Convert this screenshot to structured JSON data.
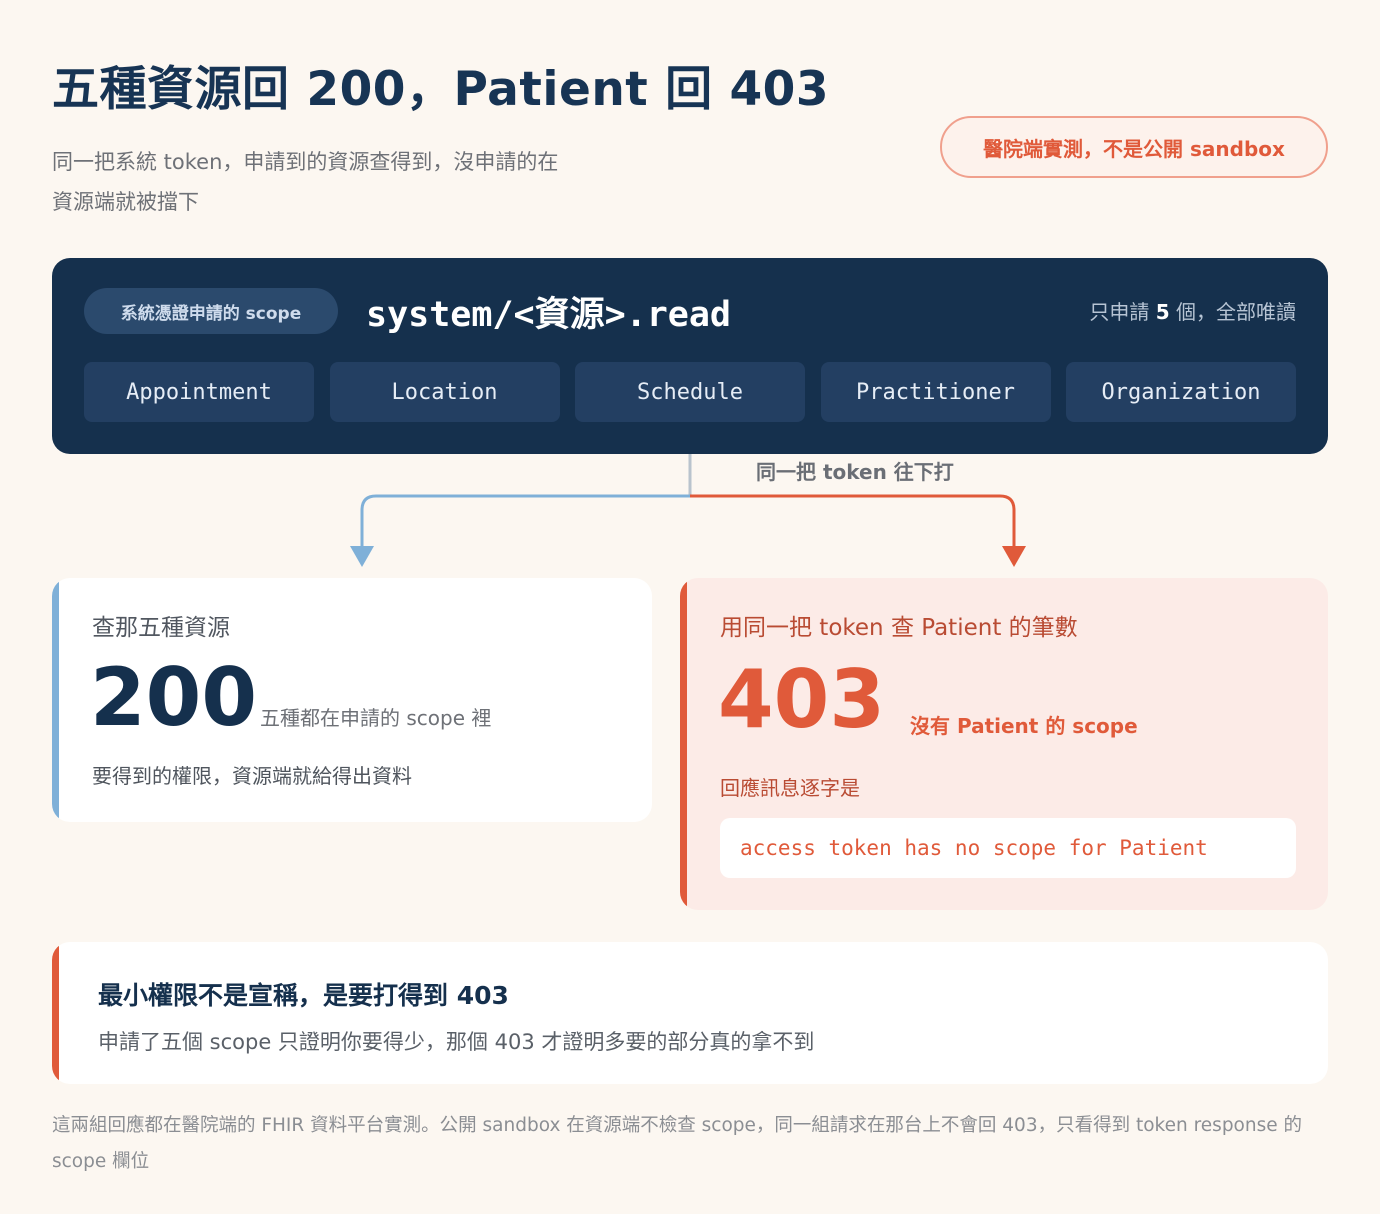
{
  "title": "五種資源回 200，Patient 回 403",
  "subtitle": "同一把系統 token，申請到的資源查得到，沒申請的在資源端就被擋下",
  "badge": "醫院端實測，不是公開 sandbox",
  "scope_panel": {
    "pill": "系統憑證申請的 scope",
    "code": "system/<資源>.read",
    "count_prefix": "只申請",
    "count_value": "5",
    "count_suffix": "個，全部唯讀",
    "resources": [
      "Appointment",
      "Location",
      "Schedule",
      "Practitioner",
      "Organization"
    ]
  },
  "flow_label": "同一把 token 往下打",
  "colors": {
    "navy": "#15304d",
    "ok_accent": "#7fb0d8",
    "deny_accent": "#e05a3a",
    "stem": "#b9c3cd"
  },
  "ok_card": {
    "heading": "查那五種資源",
    "code": "200",
    "note": "五種都在申請的 scope 裡",
    "footer": "要得到的權限，資源端就給得出資料"
  },
  "deny_card": {
    "heading": "用同一把 token 查 Patient 的筆數",
    "code": "403",
    "note": "沒有 Patient 的 scope",
    "footer": "回應訊息逐字是",
    "message": "access token has no scope for Patient"
  },
  "note_card": {
    "title": "最小權限不是宣稱，是要打得到 403",
    "body": "申請了五個 scope 只證明你要得少，那個 403 才證明多要的部分真的拿不到"
  },
  "footer": "這兩組回應都在醫院端的 FHIR 資料平台實測。公開 sandbox 在資源端不檢查 scope，同一組請求在那台上不會回 403，只看得到 token response 的 scope 欄位"
}
